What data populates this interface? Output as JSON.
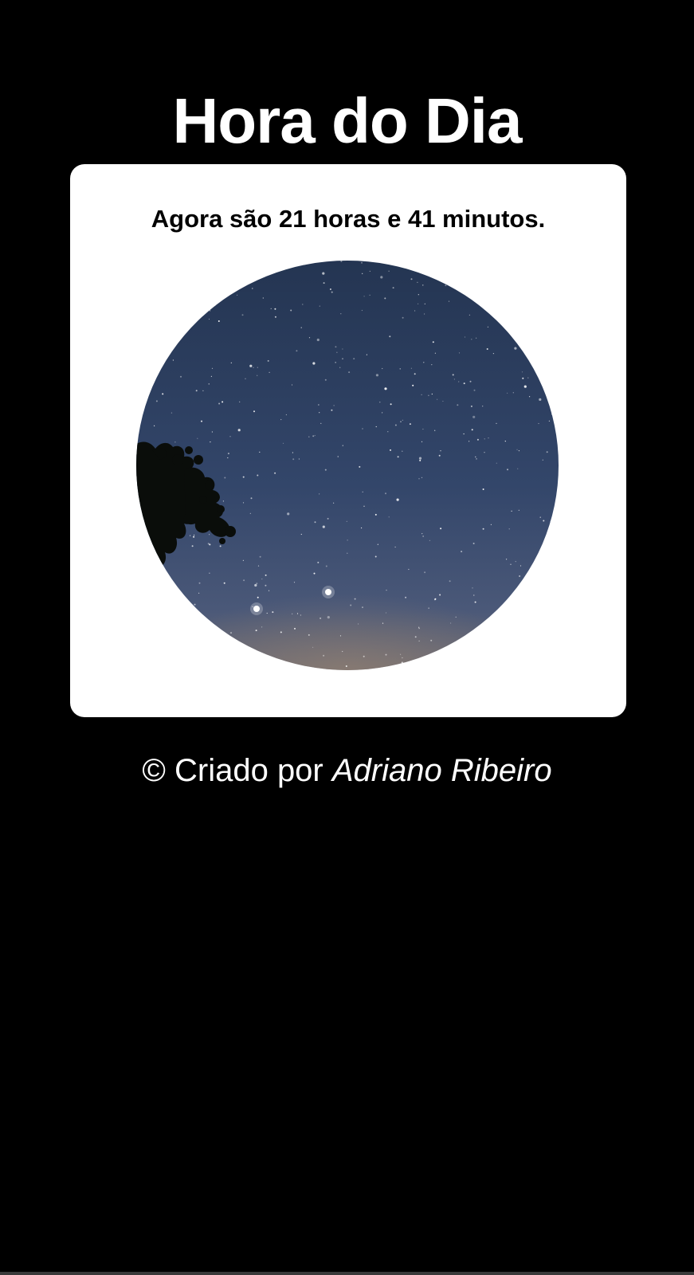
{
  "page": {
    "title": "Hora do Dia",
    "background_color": "#000000"
  },
  "card": {
    "message": "Agora são 21 horas e 41 minutos.",
    "image": {
      "subject": "night-sky",
      "colors": {
        "sky_top": "#263754",
        "sky_bottom": "#4b5a78",
        "horizon_glow": "#8a7a6a",
        "tree": "#0b0f0c",
        "stars": "#ffffff"
      }
    }
  },
  "footer": {
    "prefix": "© Criado por ",
    "author": "Adriano Ribeiro"
  }
}
